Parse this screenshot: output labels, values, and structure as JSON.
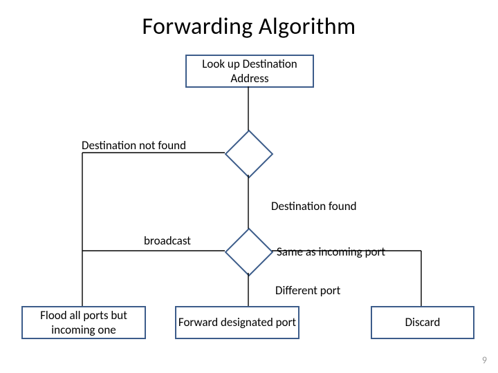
{
  "title": "Forwarding Algorithm",
  "boxes": {
    "lookup": "Look up Destination Address",
    "flood": "Flood all ports but incoming one",
    "forward": "Forward designated port",
    "discard": "Discard"
  },
  "labels": {
    "notfound": "Destination not found",
    "found": "Destination found",
    "broadcast": "broadcast",
    "sameport": "Same as incoming port",
    "diffport": "Different port"
  },
  "page": "9"
}
